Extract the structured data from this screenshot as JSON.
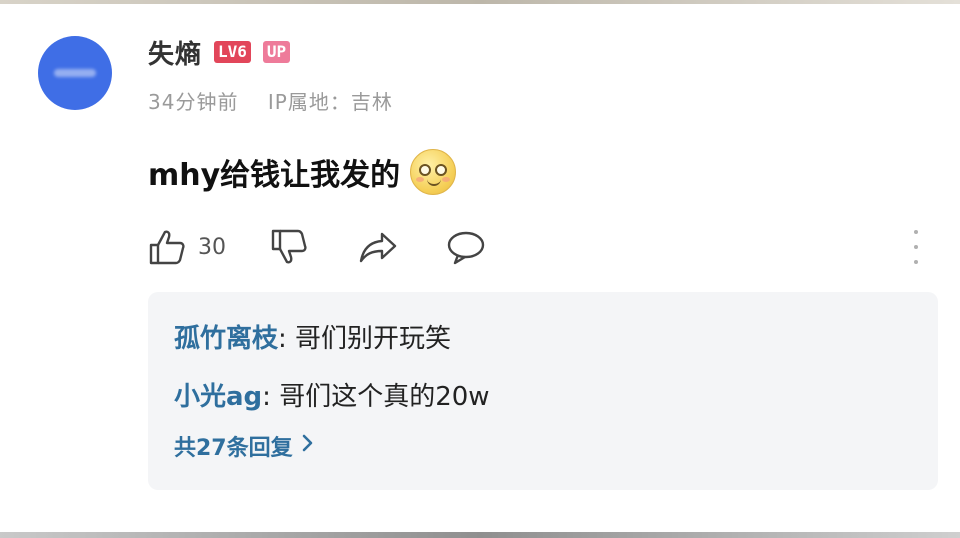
{
  "comment": {
    "username": "失熵",
    "level_badge": "LV6",
    "up_badge": "UP",
    "time": "34分钟前",
    "location": "IP属地：吉林",
    "text": "mhy给钱让我发的",
    "emoji": "smiling-face-emoji",
    "likes": "30"
  },
  "replies": {
    "items": [
      {
        "author": "孤竹离枝",
        "text": "哥们别开玩笑"
      },
      {
        "author": "小光ag",
        "text": "哥们这个真的20w"
      }
    ],
    "more_label": "共27条回复"
  },
  "icons": {
    "like": "thumbs-up-icon",
    "dislike": "thumbs-down-icon",
    "share": "share-icon",
    "reply": "comment-icon",
    "more": "more-vertical-icon",
    "chevron": "chevron-right-icon"
  },
  "colors": {
    "avatar": "#3f6ee6",
    "level_badge": "#e2465a",
    "up_badge": "#ee7b9a",
    "reply_author": "#2f6f9e",
    "reply_background": "#f4f5f7"
  }
}
